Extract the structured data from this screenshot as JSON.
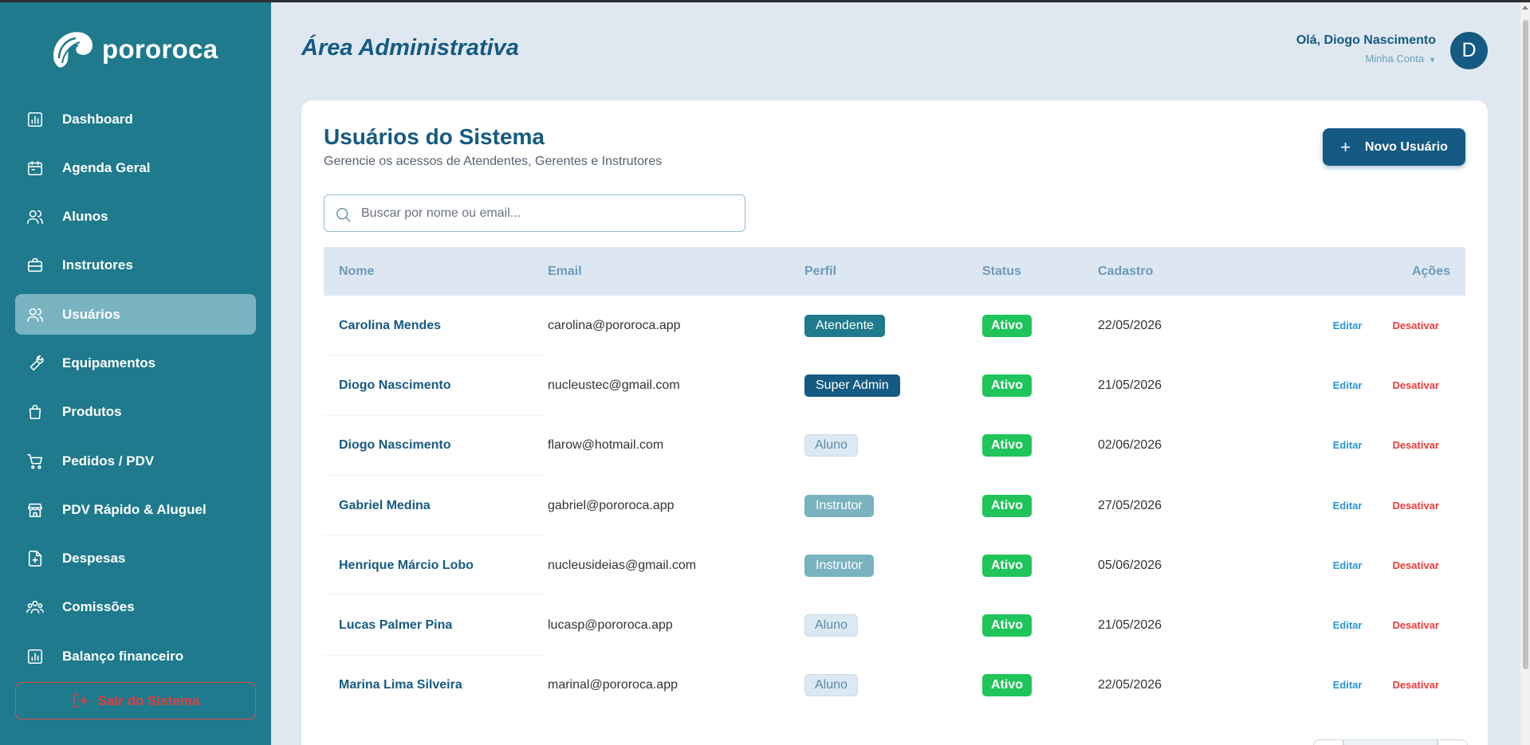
{
  "brand": {
    "name": "pororoca"
  },
  "sidebar": {
    "items": [
      {
        "label": "Dashboard",
        "icon": "chart-icon"
      },
      {
        "label": "Agenda Geral",
        "icon": "calendar-icon"
      },
      {
        "label": "Alunos",
        "icon": "users-icon"
      },
      {
        "label": "Instrutores",
        "icon": "briefcase-icon"
      },
      {
        "label": "Usuários",
        "icon": "users-icon",
        "active": true
      },
      {
        "label": "Equipamentos",
        "icon": "wrench-icon"
      },
      {
        "label": "Produtos",
        "icon": "bag-icon"
      },
      {
        "label": "Pedidos / PDV",
        "icon": "cart-icon"
      },
      {
        "label": "PDV Rápido & Aluguel",
        "icon": "store-icon"
      },
      {
        "label": "Despesas",
        "icon": "file-plus-icon"
      },
      {
        "label": "Comissões",
        "icon": "team-icon"
      },
      {
        "label": "Balanço financeiro",
        "icon": "chart-icon"
      }
    ],
    "logout_label": "Sair do Sistema"
  },
  "header": {
    "title": "Área Administrativa",
    "greeting": "Olá, Diogo Nascimento",
    "account_label": "Minha Conta",
    "avatar_initial": "D"
  },
  "main": {
    "title": "Usuários do Sistema",
    "subtitle": "Gerencie os acessos de Atendentes, Gerentes e Instrutores",
    "new_button_label": "Novo Usuário",
    "search": {
      "placeholder": "Buscar por nome ou email...",
      "value": ""
    },
    "columns": [
      "Nome",
      "Email",
      "Perfil",
      "Status",
      "Cadastro",
      "Ações"
    ],
    "rows": [
      {
        "name": "Carolina Mendes",
        "email": "carolina@pororoca.app",
        "perfil": "Atendente",
        "perfil_type": "atendente",
        "status": "Ativo",
        "cadastro": "22/05/2026"
      },
      {
        "name": "Diogo Nascimento",
        "email": "nucleustec@gmail.com",
        "perfil": "Super Admin",
        "perfil_type": "superadmin",
        "status": "Ativo",
        "cadastro": "21/05/2026"
      },
      {
        "name": "Diogo Nascimento",
        "email": "flarow@hotmail.com",
        "perfil": "Aluno",
        "perfil_type": "aluno",
        "status": "Ativo",
        "cadastro": "02/06/2026"
      },
      {
        "name": "Gabriel Medina",
        "email": "gabriel@pororoca.app",
        "perfil": "Instrutor",
        "perfil_type": "instrutor",
        "status": "Ativo",
        "cadastro": "27/05/2026"
      },
      {
        "name": "Henrique Márcio Lobo",
        "email": "nucleusideias@gmail.com",
        "perfil": "Instrutor",
        "perfil_type": "instrutor",
        "status": "Ativo",
        "cadastro": "05/06/2026"
      },
      {
        "name": "Lucas Palmer Pina",
        "email": "lucasp@pororoca.app",
        "perfil": "Aluno",
        "perfil_type": "aluno",
        "status": "Ativo",
        "cadastro": "21/05/2026"
      },
      {
        "name": "Marina Lima Silveira",
        "email": "marinal@pororoca.app",
        "perfil": "Aluno",
        "perfil_type": "aluno",
        "status": "Ativo",
        "cadastro": "22/05/2026"
      }
    ],
    "actions": {
      "edit": "Editar",
      "deactivate": "Desativar"
    }
  },
  "colors": {
    "sidebar": "#1e7a8c",
    "primary": "#155a82",
    "active_nav": "#79b3c0",
    "status_active": "#1fc45a",
    "danger": "#e83c3c",
    "link": "#2a96d4"
  }
}
